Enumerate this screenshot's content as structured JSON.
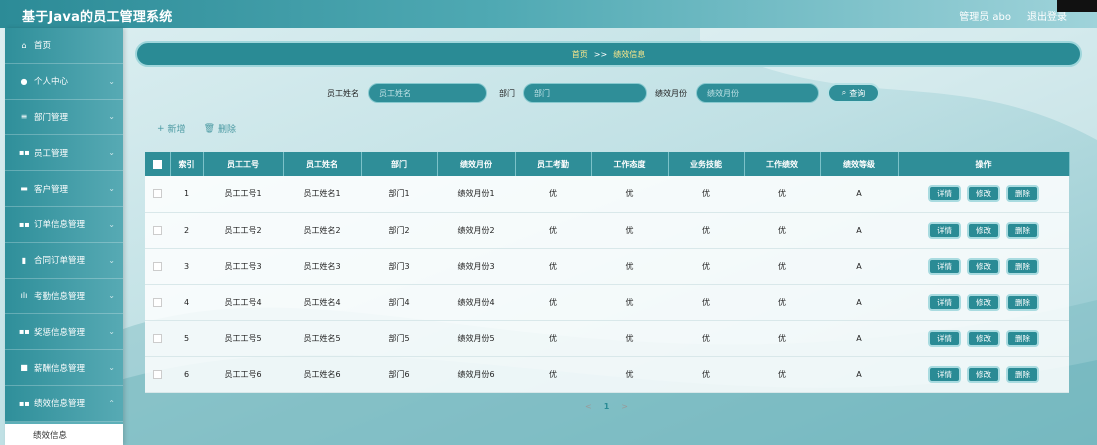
{
  "header": {
    "app_title": "基于Java的员工管理系统",
    "user_label": "管理员 abo",
    "logout_label": "退出登录"
  },
  "sidebar": {
    "items": [
      {
        "label": "首页",
        "icon": "home-icon",
        "glyph": "⌂"
      },
      {
        "label": "个人中心",
        "icon": "user-icon",
        "glyph": "●"
      },
      {
        "label": "部门管理",
        "icon": "list-icon",
        "glyph": "≡"
      },
      {
        "label": "员工管理",
        "icon": "grid-icon",
        "glyph": "▪▪"
      },
      {
        "label": "客户管理",
        "icon": "card-icon",
        "glyph": "▬"
      },
      {
        "label": "订单信息管理",
        "icon": "grid-icon",
        "glyph": "▪▪"
      },
      {
        "label": "合同订单管理",
        "icon": "doc-icon",
        "glyph": "▮"
      },
      {
        "label": "考勤信息管理",
        "icon": "bar-chart-icon",
        "glyph": "ılı"
      },
      {
        "label": "奖惩信息管理",
        "icon": "grid-icon",
        "glyph": "▪▪"
      },
      {
        "label": "薪酬信息管理",
        "icon": "box-icon",
        "glyph": "■"
      },
      {
        "label": "绩效信息管理",
        "icon": "grid-icon",
        "glyph": "▪▪"
      }
    ],
    "active_sub": "绩效信息"
  },
  "breadcrumb": {
    "home": "首页",
    "separator": ">>",
    "current": "绩效信息"
  },
  "search": {
    "name_label": "员工姓名",
    "name_placeholder": "员工姓名",
    "dept_label": "部门",
    "dept_placeholder": "部门",
    "month_label": "绩效月份",
    "month_placeholder": "绩效月份",
    "button_label": "查询"
  },
  "actions": {
    "add_label": "新增",
    "delete_label": "删除"
  },
  "table": {
    "headers": [
      "索引",
      "员工工号",
      "员工姓名",
      "部门",
      "绩效月份",
      "员工考勤",
      "工作态度",
      "业务技能",
      "工作绩效",
      "绩效等级",
      "操作"
    ],
    "rows": [
      [
        "1",
        "员工工号1",
        "员工姓名1",
        "部门1",
        "绩效月份1",
        "优",
        "优",
        "优",
        "优",
        "A"
      ],
      [
        "2",
        "员工工号2",
        "员工姓名2",
        "部门2",
        "绩效月份2",
        "优",
        "优",
        "优",
        "优",
        "A"
      ],
      [
        "3",
        "员工工号3",
        "员工姓名3",
        "部门3",
        "绩效月份3",
        "优",
        "优",
        "优",
        "优",
        "A"
      ],
      [
        "4",
        "员工工号4",
        "员工姓名4",
        "部门4",
        "绩效月份4",
        "优",
        "优",
        "优",
        "优",
        "A"
      ],
      [
        "5",
        "员工工号5",
        "员工姓名5",
        "部门5",
        "绩效月份5",
        "优",
        "优",
        "优",
        "优",
        "A"
      ],
      [
        "6",
        "员工工号6",
        "员工姓名6",
        "部门6",
        "绩效月份6",
        "优",
        "优",
        "优",
        "优",
        "A"
      ]
    ],
    "row_actions": {
      "detail": "详情",
      "edit": "修改",
      "delete": "删除"
    }
  },
  "pagination": {
    "prev": "<",
    "current": "1",
    "next": ">"
  },
  "colors": {
    "primary": "#2f8e98",
    "accent_text": "#ffe98a"
  }
}
